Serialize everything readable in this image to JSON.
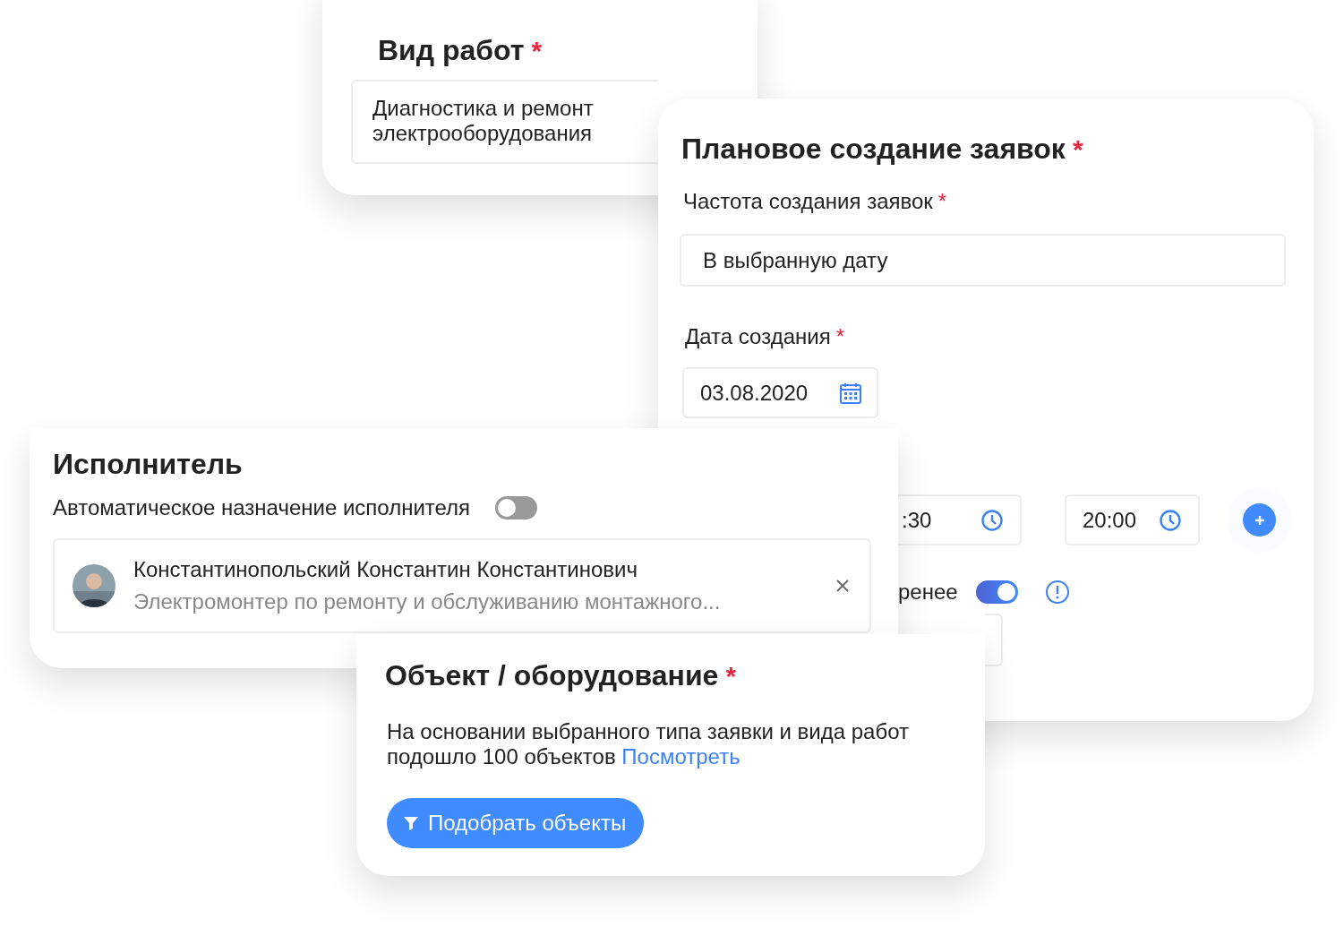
{
  "work_type_card": {
    "title": "Вид работ",
    "required_mark": "*",
    "value": "Диагностика и ремонт электрооборудования"
  },
  "schedule_card": {
    "title": "Плановое создание заявок",
    "required_mark": "*",
    "frequency_label": "Частота создания заявок",
    "frequency_required_mark": "*",
    "frequency_value": "В выбранную дату",
    "date_label": "Дата создания",
    "date_required_mark": "*",
    "date_value": "03.08.2020",
    "times": [
      ":30",
      "20:00"
    ],
    "advance_label": "ренее",
    "advance_on": true
  },
  "executor_card": {
    "title": "Исполнитель",
    "auto_assign_label": "Автоматическое назначение исполнителя",
    "auto_assign_on": false,
    "person": {
      "name": "Константинопольский Константин Константинович",
      "position": "Электромонтер по ремонту и обслуживанию монтажного..."
    }
  },
  "object_card": {
    "title": "Объект / оборудование",
    "required_mark": "*",
    "description": "На основании выбранного типа заявки и вида работ подошло 100 объектов",
    "link": "Посмотреть",
    "button": "Подобрать объекты"
  }
}
